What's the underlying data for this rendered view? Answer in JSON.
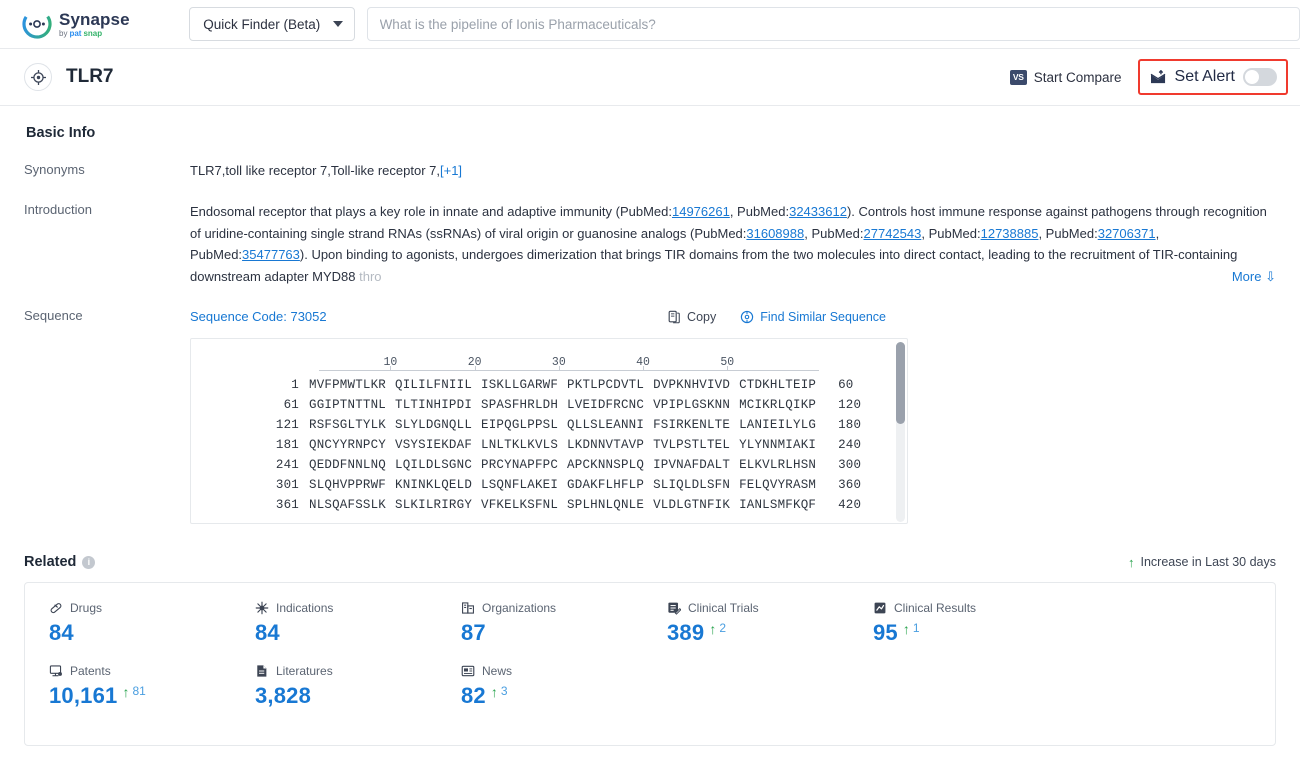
{
  "topbar": {
    "logo_name": "Synapse",
    "logo_by": "by",
    "logo_brand_1": "pat",
    "logo_brand_2": "snap",
    "finder_label": "Quick Finder (Beta)",
    "search_placeholder": "What is the pipeline of Ionis Pharmaceuticals?",
    "search_value": ""
  },
  "entity": {
    "title": "TLR7",
    "start_compare": "Start Compare",
    "vs_badge": "VS",
    "set_alert": "Set Alert",
    "alert_enabled": false,
    "highlight_color": "#f03a2e"
  },
  "basic_info": {
    "heading": "Basic Info",
    "synonyms_label": "Synonyms",
    "synonyms_value": "TLR7,toll like receptor 7,Toll-like receptor 7,",
    "synonyms_more": "[+1]",
    "introduction_label": "Introduction",
    "introduction": {
      "seg1": "Endosomal receptor that plays a key role in innate and adaptive immunity (PubMed:",
      "pm1": "14976261",
      "seg2": ", PubMed:",
      "pm2": "32433612",
      "seg3": "). Controls host immune response against pathogens through recognition of uridine-containing single strand RNAs (ssRNAs) of viral origin or guanosine analogs (PubMed:",
      "pm3": "31608988",
      "seg4": ", PubMed:",
      "pm4": "27742543",
      "seg5": ", PubMed:",
      "pm5": "12738885",
      "seg6": ", PubMed:",
      "pm6": "32706371",
      "seg7": ", PubMed:",
      "pm7": "35477763",
      "seg8": "). Upon binding to agonists, undergoes dimerization that brings TIR domains from the two molecules into direct contact, leading to the recruitment of TIR-containing downstream adapter MYD88",
      "fade": " thro",
      "more_label": "More"
    }
  },
  "sequence": {
    "label": "Sequence",
    "code_label": "Sequence Code: 73052",
    "copy_label": "Copy",
    "find_similar_label": "Find Similar Sequence",
    "ruler_ticks": [
      10,
      20,
      30,
      40,
      50
    ],
    "rows": [
      {
        "start": "1",
        "chunks": [
          "MVFPMWTLKR",
          "QILILFNIIL",
          "ISKLLGARWF",
          "PKTLPCDVTL",
          "DVPKNHVIVD",
          "CTDKHLTEIP"
        ],
        "end": "60"
      },
      {
        "start": "61",
        "chunks": [
          "GGIPTNTTNL",
          "TLTINHIPDI",
          "SPASFHRLDH",
          "LVEIDFRCNC",
          "VPIPLGSKNN",
          "MCIKRLQIKP"
        ],
        "end": "120"
      },
      {
        "start": "121",
        "chunks": [
          "RSFSGLTYLK",
          "SLYLDGNQLL",
          "EIPQGLPPSL",
          "QLLSLEANNI",
          "FSIRKENLTE",
          "LANIEILYLG"
        ],
        "end": "180"
      },
      {
        "start": "181",
        "chunks": [
          "QNCYYRNPCY",
          "VSYSIEKDAF",
          "LNLTKLKVLS",
          "LKDNNVTAVP",
          "TVLPSTLTEL",
          "YLYNNMIAKI"
        ],
        "end": "240"
      },
      {
        "start": "241",
        "chunks": [
          "QEDDFNNLNQ",
          "LQILDLSGNC",
          "PRCYNAPFPC",
          "APCKNNSPLQ",
          "IPVNAFDALT",
          "ELKVLRLHSN"
        ],
        "end": "300"
      },
      {
        "start": "301",
        "chunks": [
          "SLQHVPPRWF",
          "KNINKLQELD",
          "LSQNFLAKEI",
          "GDAKFLHFLP",
          "SLIQLDLSFN",
          "FELQVYRASM"
        ],
        "end": "360"
      },
      {
        "start": "361",
        "chunks": [
          "NLSQAFSSLK",
          "SLKILRIRGY",
          "VFKELKSFNL",
          "SPLHNLQNLE",
          "VLDLGTNFIK",
          "IANLSMFKQF"
        ],
        "end": "420"
      }
    ]
  },
  "related": {
    "title": "Related",
    "legend": "Increase in Last 30 days",
    "accent_color": "#1878d3",
    "increase_color": "#2aa44f",
    "stats": [
      {
        "icon": "pill-icon",
        "label": "Drugs",
        "value": "84",
        "delta": ""
      },
      {
        "icon": "virus-icon",
        "label": "Indications",
        "value": "84",
        "delta": ""
      },
      {
        "icon": "organization-icon",
        "label": "Organizations",
        "value": "87",
        "delta": ""
      },
      {
        "icon": "clinical-trial-icon",
        "label": "Clinical Trials",
        "value": "389",
        "delta": "2"
      },
      {
        "icon": "clinical-result-icon",
        "label": "Clinical Results",
        "value": "95",
        "delta": "1"
      },
      {
        "icon": "patent-icon",
        "label": "Patents",
        "value": "10,161",
        "delta": "81"
      },
      {
        "icon": "literature-icon",
        "label": "Literatures",
        "value": "3,828",
        "delta": ""
      },
      {
        "icon": "news-icon",
        "label": "News",
        "value": "82",
        "delta": "3"
      }
    ]
  }
}
